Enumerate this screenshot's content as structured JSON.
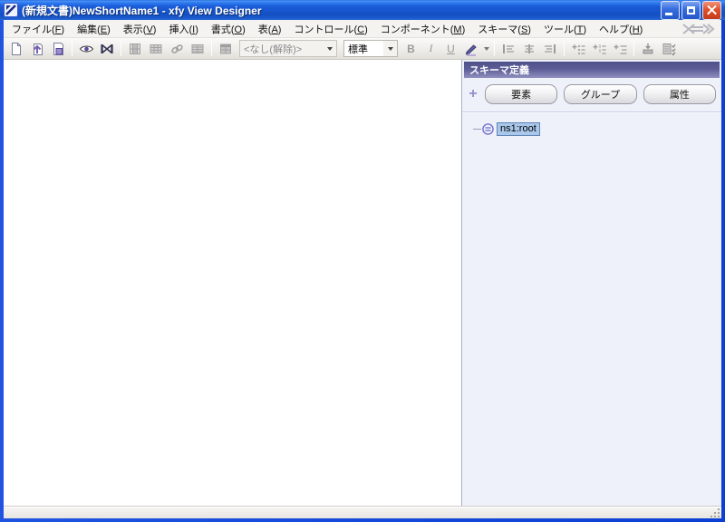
{
  "window": {
    "title": "(新規文書)NewShortName1 - xfy View Designer"
  },
  "menubar": {
    "items": [
      "ファイル(F)",
      "編集(E)",
      "表示(V)",
      "挿入(I)",
      "書式(O)",
      "表(A)",
      "コントロール(C)",
      "コンポーネント(M)",
      "スキーマ(S)",
      "ツール(T)",
      "ヘルプ(H)"
    ]
  },
  "toolbar": {
    "component_combo": {
      "value": "<なし(解除)>"
    },
    "style_combo": {
      "value": "標準"
    },
    "bold_label": "B",
    "italic_label": "I",
    "underline_label": "U"
  },
  "schema_panel": {
    "title": "スキーマ定義",
    "add_icon": "+",
    "buttons": {
      "element": "要素",
      "group": "グループ",
      "attribute": "属性"
    },
    "tree": {
      "root_label": "ns1:root"
    }
  },
  "statusbar": {
    "text": ""
  },
  "colors": {
    "titlebar_blue": "#1a5cd8",
    "window_border": "#0d3fd4",
    "panel_header": "#56568f",
    "panel_bg": "#eef0fa",
    "selection_bg": "#a9c7ea",
    "close_red": "#d8491f"
  },
  "icons": {
    "app_icon": "xfy-diagonal-pen",
    "minimize_icon": "underscore-bar",
    "maximize_icon": "square-outline",
    "close_icon": "x-cross",
    "xfy_logo_icon": "x-arrow-logo",
    "new_document_icon": "blank-page",
    "open_icon": "page-up-arrow",
    "paste_icon": "page-with-board",
    "preview_eye_icon": "eye",
    "component_x_icon": "crossed-box",
    "insert_component_icon": "grid-table",
    "table_icon": "grid-table",
    "link_icon": "chain-links",
    "merge_cells_icon": "grid-table",
    "table_dark_icon": "grid-table",
    "dropdown_arrow_icon": "triangle-down",
    "highlight_pen_icon": "highlighter",
    "align_left_icon": "bar-lines-left",
    "align_center_icon": "bar-lines-center",
    "align_right_icon": "bar-lines-right",
    "add_bullet_list_icon": "plus-bullet-list",
    "add_numbered_list_icon": "plus-numbered-list",
    "add_list_icon": "plus-dash-list",
    "insert_bar_icon": "bar-down-arrow",
    "checklist_icon": "box-checkmarks",
    "add_icon": "plus",
    "element_tree_icon": "circle-with-lines",
    "tree_branch_icon": "dash-line",
    "resize_grip_icon": "diagonal-dots"
  }
}
